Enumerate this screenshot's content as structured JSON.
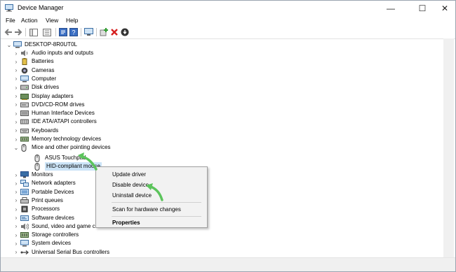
{
  "window": {
    "title": "Device Manager",
    "minimize_glyph": "—",
    "maximize_glyph": "☐",
    "close_glyph": "✕"
  },
  "menu": [
    "File",
    "Action",
    "View",
    "Help"
  ],
  "toolbar": {
    "icons": [
      "back-icon",
      "forward-icon",
      "console-tree-icon",
      "show-hide-icon",
      "properties-icon",
      "help-icon",
      "scan-hardware-icon",
      "add-driver-icon",
      "uninstall-icon",
      "update-driver-icon"
    ]
  },
  "tree": {
    "root": "DESKTOP-8R0UT0L",
    "categories": [
      {
        "label": "Audio inputs and outputs",
        "icon": "speaker-icon"
      },
      {
        "label": "Batteries",
        "icon": "battery-icon"
      },
      {
        "label": "Cameras",
        "icon": "camera-icon"
      },
      {
        "label": "Computer",
        "icon": "computer-icon"
      },
      {
        "label": "Disk drives",
        "icon": "disk-icon"
      },
      {
        "label": "Display adapters",
        "icon": "display-adapter-icon"
      },
      {
        "label": "DVD/CD-ROM drives",
        "icon": "dvd-icon"
      },
      {
        "label": "Human Interface Devices",
        "icon": "hid-icon"
      },
      {
        "label": "IDE ATA/ATAPI controllers",
        "icon": "ide-icon"
      },
      {
        "label": "Keyboards",
        "icon": "keyboard-icon"
      },
      {
        "label": "Memory technology devices",
        "icon": "memory-icon"
      },
      {
        "label": "Mice and other pointing devices",
        "icon": "mouse-icon"
      }
    ],
    "mice_children": [
      "ASUS Touchpad",
      "HID-compliant mouse"
    ],
    "categories_after": [
      {
        "label": "Monitors",
        "icon": "monitor-icon"
      },
      {
        "label": "Network adapters",
        "icon": "network-icon"
      },
      {
        "label": "Portable Devices",
        "icon": "portable-device-icon"
      },
      {
        "label": "Print queues",
        "icon": "printer-icon"
      },
      {
        "label": "Processors",
        "icon": "processor-icon"
      },
      {
        "label": "Software devices",
        "icon": "software-device-icon"
      },
      {
        "label": "Sound, video and game controllers",
        "icon": "sound-icon"
      },
      {
        "label": "Storage controllers",
        "icon": "storage-icon"
      },
      {
        "label": "System devices",
        "icon": "system-icon"
      },
      {
        "label": "Universal Serial Bus controllers",
        "icon": "usb-icon"
      }
    ]
  },
  "context_menu": {
    "update_driver": "Update driver",
    "disable_device": "Disable device",
    "uninstall_device": "Uninstall device",
    "scan": "Scan for hardware changes",
    "properties": "Properties"
  },
  "colors": {
    "selection": "#cce4f7",
    "annotation_arrow": "#5cc45c"
  }
}
